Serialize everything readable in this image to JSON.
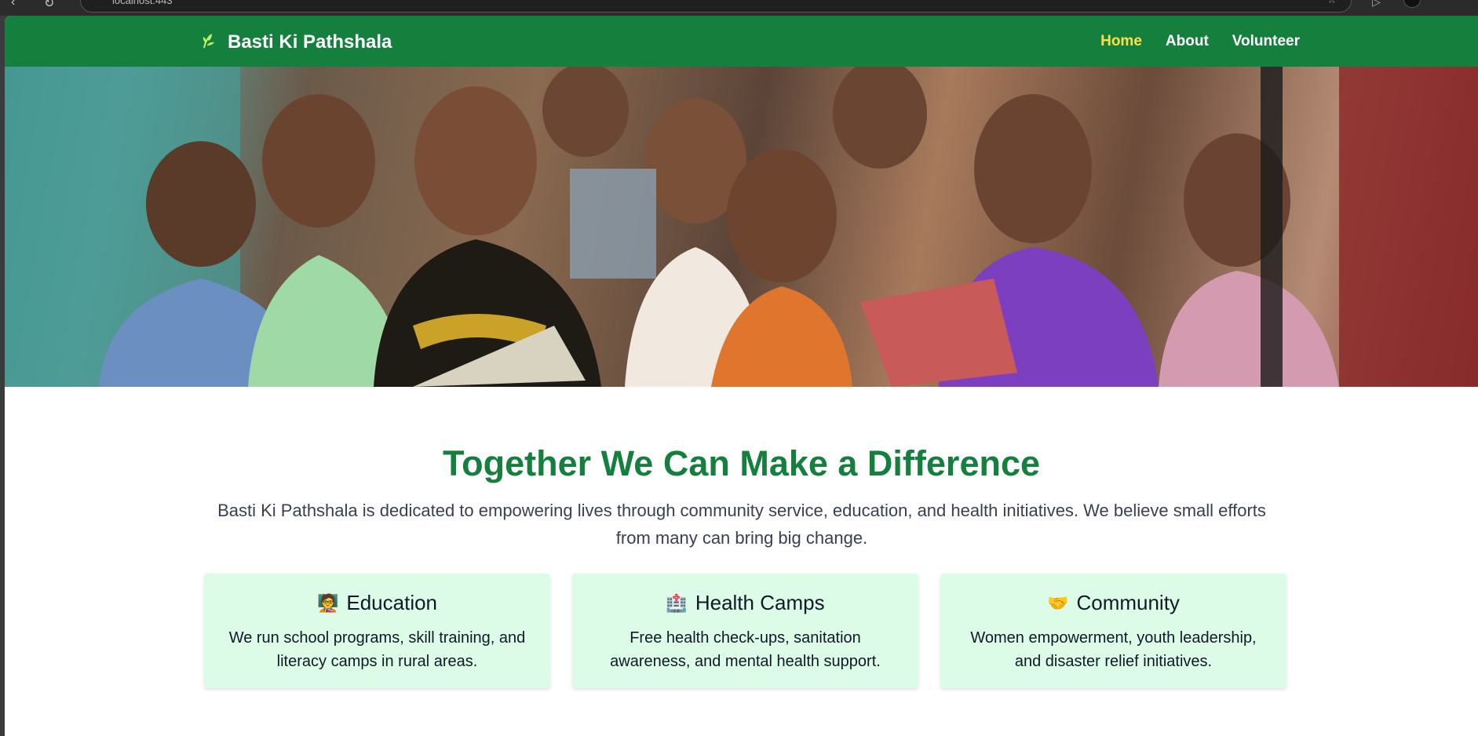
{
  "browser": {
    "address": "localhost:443"
  },
  "header": {
    "brand_icon": "leaf-icon",
    "brand_name": "Basti Ki Pathshala",
    "nav": [
      {
        "label": "Home",
        "active": true
      },
      {
        "label": "About",
        "active": false
      },
      {
        "label": "Volunteer",
        "active": false
      }
    ]
  },
  "hero": {
    "image": "children-smiling-holding-books-photo"
  },
  "main": {
    "title": "Together We Can Make a Difference",
    "mission": "Basti Ki Pathshala is dedicated to empowering lives through community service, education, and health initiatives. We believe small efforts from many can bring big change."
  },
  "cards": [
    {
      "icon": "teacher-icon",
      "glyph": "🧑‍🏫",
      "title": "Education",
      "description": "We run school programs, skill training, and literacy camps in rural areas."
    },
    {
      "icon": "hospital-icon",
      "glyph": "🏥",
      "title": "Health Camps",
      "description": "Free health check-ups, sanitation awareness, and mental health support."
    },
    {
      "icon": "handshake-icon",
      "glyph": "🤝",
      "title": "Community",
      "description": "Women empowerment, youth leadership, and disaster relief initiatives."
    }
  ],
  "colors": {
    "primary_green": "#15803d",
    "active_nav": "#fde047",
    "card_bg": "#dcfce7"
  }
}
